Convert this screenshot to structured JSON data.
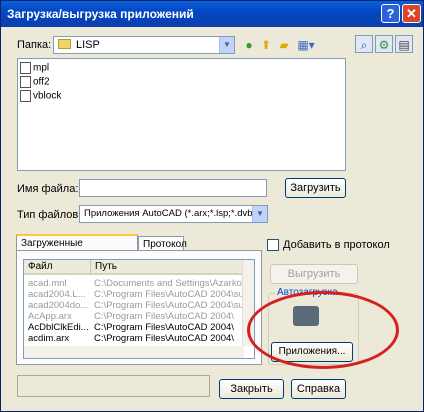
{
  "window": {
    "title": "Загрузка/выгрузка приложений",
    "help_btn": "?",
    "close_btn": "✕"
  },
  "lookin": {
    "label": "Папка:",
    "value": "LISP"
  },
  "files": [
    "mpl",
    "off2",
    "vblock"
  ],
  "filename": {
    "label": "Имя файла:",
    "value": ""
  },
  "filetype": {
    "label": "Тип файлов:",
    "value": "Приложения AutoCAD (*.arx;*.lsp;*.dvb;*.dt"
  },
  "load_btn": "Загрузить",
  "tabs": [
    "Загруженные приложения",
    "Протокол"
  ],
  "grid": {
    "headers": [
      "Файл",
      "Путь"
    ],
    "rows": [
      {
        "file": "acad.mnl",
        "path": "C:\\Documents and Settings\\Azarko...",
        "grey": true
      },
      {
        "file": "acad2004.L...",
        "path": "C:\\Program Files\\AutoCAD 2004\\su...",
        "grey": true
      },
      {
        "file": "acad2004do...",
        "path": "C:\\Program Files\\AutoCAD 2004\\su...",
        "grey": true
      },
      {
        "file": "AcApp.arx",
        "path": "C:\\Program Files\\AutoCAD 2004\\",
        "grey": true
      },
      {
        "file": "AcDblClkEdi...",
        "path": "C:\\Program Files\\AutoCAD 2004\\",
        "grey": false
      },
      {
        "file": "acdim.arx",
        "path": "C:\\Program Files\\AutoCAD 2004\\",
        "grey": false
      }
    ]
  },
  "add_to_history": "Добавить в протокол",
  "unload_btn": "Выгрузить",
  "startup": {
    "title": "Автозагрузка",
    "contents_btn": "Приложения..."
  },
  "close_btn": "Закрыть",
  "help_btn": "Справка",
  "colors": {
    "titlebar": "#0347c3",
    "annotation": "#d62020",
    "accent": "#0046d5"
  }
}
